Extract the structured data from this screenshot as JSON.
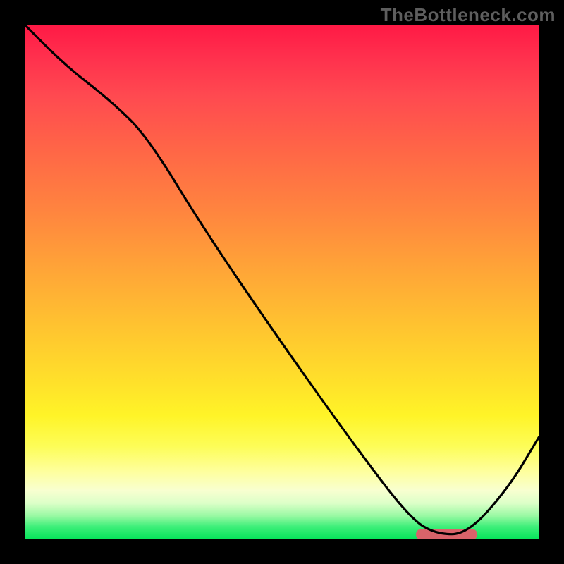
{
  "watermark_text": "TheBottleneck.com",
  "chart_data": {
    "type": "line",
    "title": "",
    "xlabel": "",
    "ylabel": "",
    "xlim": [
      0,
      100
    ],
    "ylim": [
      0,
      100
    ],
    "grid": false,
    "series": [
      {
        "name": "curve",
        "x": [
          0,
          8,
          17,
          24,
          35,
          50,
          65,
          75,
          80,
          86,
          94,
          100
        ],
        "values": [
          100,
          92,
          85,
          78,
          60,
          38,
          17,
          4,
          1,
          1,
          10,
          20
        ]
      }
    ],
    "minimum_marker": {
      "x_start": 76,
      "x_end": 88,
      "y": 1,
      "color": "#d9636a"
    }
  },
  "colors": {
    "curve_stroke": "#000000",
    "marker_fill": "#d9636a",
    "frame_bg": "#000000"
  }
}
